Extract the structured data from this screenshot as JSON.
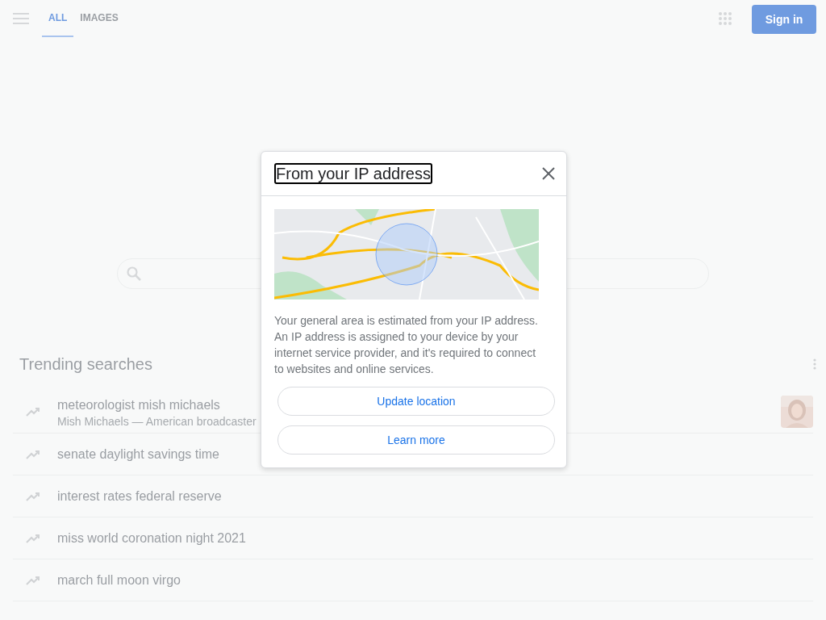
{
  "header": {
    "tabs": [
      {
        "label": "ALL",
        "selected": true
      },
      {
        "label": "IMAGES",
        "selected": false
      }
    ],
    "sign_in": "Sign in"
  },
  "trending": {
    "title": "Trending searches",
    "items": [
      {
        "title": "meteorologist mish michaels",
        "subtitle": "Mish Michaels — American broadcaster"
      },
      {
        "title": "senate daylight savings time"
      },
      {
        "title": "interest rates federal reserve"
      },
      {
        "title": "miss world coronation night 2021"
      },
      {
        "title": "march full moon virgo"
      }
    ]
  },
  "dialog": {
    "title": "From your IP address",
    "title_focused": true,
    "body": "Your general area is estimated from your IP address. An IP address is assigned to your device by your internet service provider, and it's required to connect to websites and online services.",
    "buttons": [
      "Update location",
      "Learn more"
    ]
  }
}
